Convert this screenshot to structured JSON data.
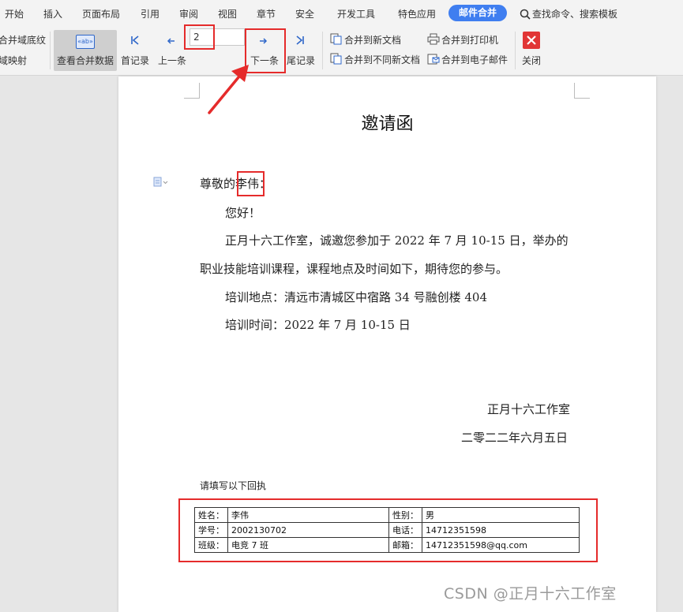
{
  "menu": {
    "tabs": [
      "开始",
      "插入",
      "页面布局",
      "引用",
      "审阅",
      "视图",
      "章节",
      "安全",
      "开发工具",
      "特色应用",
      "邮件合并"
    ],
    "active_tab": "邮件合并",
    "search_placeholder": "查找命令、搜索模板"
  },
  "ribbon": {
    "field_shading": "合并域底纹",
    "field_mapping": "域映射",
    "view_merged": "查看合并数据",
    "view_icon_text": "«ab»",
    "first_record": "首记录",
    "prev_record": "上一条",
    "record_number": "2",
    "next_record": "下一条",
    "last_record": "尾记录",
    "merge_new_doc": "合并到新文档",
    "merge_separate_docs": "合并到不同新文档",
    "merge_printer": "合并到打印机",
    "merge_email": "合并到电子邮件",
    "close": "关闭"
  },
  "document": {
    "title": "邀请函",
    "salutation_prefix": "尊敬的",
    "salutation_name": "李伟",
    "salutation_suffix": "：",
    "greeting": "您好！",
    "body_line1": "正月十六工作室，诚邀您参加于 2022 年 7 月 10-15 日，举办的",
    "body_line2": "职业技能培训课程，课程地点及时间如下，期待您的参与。",
    "location": "培训地点：清远市清城区中宿路 34 号融创楼 404",
    "time": "培训时间：2022 年 7 月 10-15 日",
    "signature_org": "正月十六工作室",
    "signature_date": "二零二二年六月五日",
    "receipt_heading": "请填写以下回执",
    "receipt": [
      {
        "k1": "姓名：",
        "v1": "李伟",
        "k2": "性别：",
        "v2": "男"
      },
      {
        "k1": "学号：",
        "v1": "2002130702",
        "k2": "电话：",
        "v2": "14712351598"
      },
      {
        "k1": "班级：",
        "v1": "电竞 7 班",
        "k2": "邮箱：",
        "v2": "14712351598@qq.com"
      }
    ]
  },
  "watermark": "CSDN @正月十六工作室",
  "colors": {
    "accent": "#3f7ef0",
    "highlight_box": "#e52b2b",
    "arrow": "#e52b2b",
    "close_button": "#e13636"
  }
}
